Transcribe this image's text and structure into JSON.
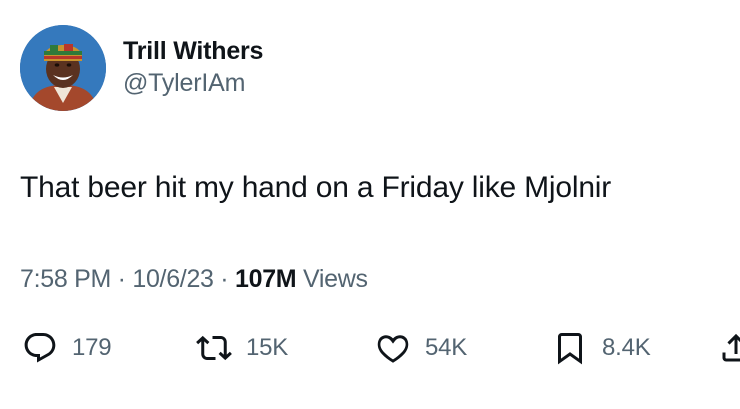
{
  "author": {
    "display_name": "Trill Withers",
    "handle": "@TylerIAm"
  },
  "tweet": {
    "text": "That beer hit my hand on a Friday like Mjolnir"
  },
  "meta": {
    "time": "7:58 PM",
    "separator_1": " · ",
    "date": "10/6/23",
    "separator_2": " · ",
    "views_count": "107M",
    "views_label": " Views"
  },
  "actions": {
    "reply_count": "179",
    "retweet_count": "15K",
    "like_count": "54K",
    "bookmark_count": "8.4K"
  },
  "icons": {
    "reply": "reply-icon",
    "retweet": "retweet-icon",
    "like": "heart-icon",
    "bookmark": "bookmark-icon",
    "share": "share-icon"
  },
  "colors": {
    "text_primary": "#0f1419",
    "text_secondary": "#536471",
    "background": "#ffffff"
  }
}
